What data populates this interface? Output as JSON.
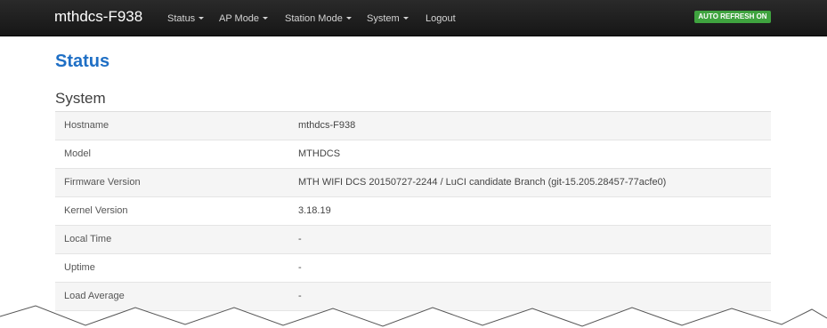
{
  "header": {
    "brand": "mthdcs-F938",
    "menu": [
      {
        "label": "Status"
      },
      {
        "label": "AP Mode"
      },
      {
        "label": "Station Mode"
      },
      {
        "label": "System"
      },
      {
        "label": "Logout"
      }
    ],
    "auto_refresh_label": "AUTO REFRESH ON",
    "colors": {
      "navbar": "#1c1c1c",
      "auto_refresh_badge": "#3fa33f",
      "title": "#1f6fc5"
    }
  },
  "main": {
    "page_title": "Status",
    "section_title": "System",
    "rows": [
      {
        "label": "Hostname",
        "value": "mthdcs-F938"
      },
      {
        "label": "Model",
        "value": "MTHDCS"
      },
      {
        "label": "Firmware Version",
        "value": "MTH WIFI DCS 20150727-2244 / LuCI candidate Branch (git-15.205.28457-77acfe0)"
      },
      {
        "label": "Kernel Version",
        "value": "3.18.19"
      },
      {
        "label": "Local Time",
        "value": "-"
      },
      {
        "label": "Uptime",
        "value": "-"
      },
      {
        "label": "Load Average",
        "value": "-"
      }
    ]
  }
}
